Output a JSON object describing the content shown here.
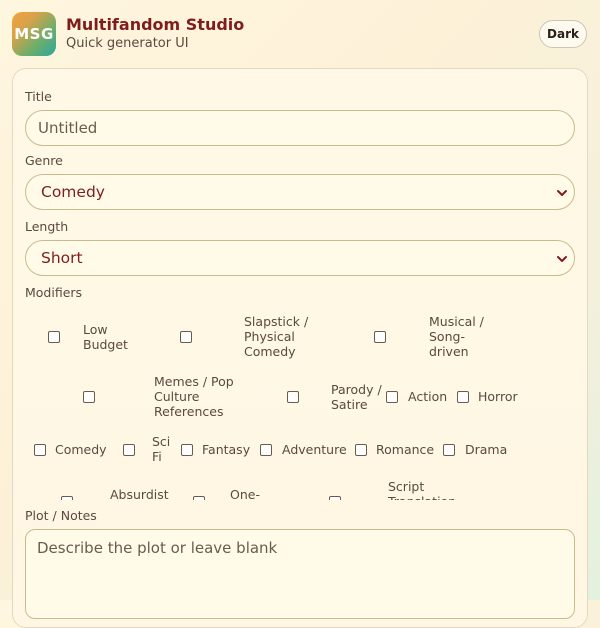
{
  "app": {
    "logo_text": "MSG",
    "title": "Multifandom Studio",
    "subtitle": "Quick generator UI",
    "theme_toggle_label": "Dark"
  },
  "form": {
    "title_label": "Title",
    "title_placeholder": "Untitled",
    "title_value": "",
    "genre_label": "Genre",
    "genre_selected": "Comedy",
    "length_label": "Length",
    "length_selected": "Short",
    "modifiers_label": "Modifiers",
    "modifiers": [
      {
        "label": "Low Budget",
        "checked": false
      },
      {
        "label": "Slapstick / Physical Comedy",
        "checked": false
      },
      {
        "label": "Musical / Song-driven",
        "checked": false
      },
      {
        "label": "Memes / Pop Culture References",
        "checked": false
      },
      {
        "label": "Parody / Satire",
        "checked": false
      },
      {
        "label": "Action",
        "checked": false
      },
      {
        "label": "Horror",
        "checked": false
      },
      {
        "label": "Comedy",
        "checked": false
      },
      {
        "label": "Sci Fi",
        "checked": false
      },
      {
        "label": "Fantasy",
        "checked": false
      },
      {
        "label": "Adventure",
        "checked": false
      },
      {
        "label": "Romance",
        "checked": false
      },
      {
        "label": "Drama",
        "checked": false
      },
      {
        "label": "Absurdist",
        "checked": false
      },
      {
        "label": "One-",
        "checked": false
      },
      {
        "label": "Script Translation",
        "checked": false
      }
    ],
    "plot_label": "Plot / Notes",
    "plot_placeholder": "Describe the plot or leave blank",
    "plot_value": ""
  },
  "colors": {
    "accent": "#7f1d1d",
    "field_border": "#c9bb8e",
    "field_bg": "#fffbe8"
  }
}
